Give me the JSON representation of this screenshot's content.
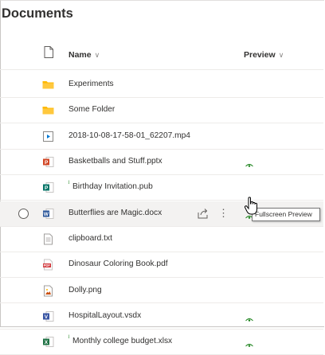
{
  "title": "Documents",
  "header": {
    "name_label": "Name",
    "preview_label": "Preview",
    "chevron": "∨"
  },
  "files": [
    {
      "name": "Experiments",
      "icon": "folder-icon",
      "type": "folder",
      "new": false,
      "preview": false
    },
    {
      "name": "Some Folder",
      "icon": "folder-icon",
      "type": "folder",
      "new": false,
      "preview": false
    },
    {
      "name": "2018-10-08-17-58-01_62207.mp4",
      "icon": "video-file-icon",
      "type": "video",
      "new": false,
      "preview": false
    },
    {
      "name": "Basketballs and Stuff.pptx",
      "icon": "powerpoint-file-icon",
      "type": "pptx",
      "new": false,
      "preview": true
    },
    {
      "name": "Birthday Invitation.pub",
      "icon": "publisher-file-icon",
      "type": "pub",
      "new": true,
      "preview": false
    },
    {
      "name": "Butterflies are Magic.docx",
      "icon": "word-file-icon",
      "type": "docx",
      "new": false,
      "preview": true,
      "selected_hover": true
    },
    {
      "name": "clipboard.txt",
      "icon": "text-file-icon",
      "type": "txt",
      "new": false,
      "preview": false
    },
    {
      "name": "Dinosaur Coloring Book.pdf",
      "icon": "pdf-file-icon",
      "type": "pdf",
      "new": false,
      "preview": false
    },
    {
      "name": "Dolly.png",
      "icon": "image-file-icon",
      "type": "png",
      "new": false,
      "preview": false
    },
    {
      "name": "HospitalLayout.vsdx",
      "icon": "visio-file-icon",
      "type": "vsdx",
      "new": false,
      "preview": true
    },
    {
      "name": "Monthly college budget.xlsx",
      "icon": "excel-file-icon",
      "type": "xlsx",
      "new": true,
      "preview": true
    }
  ],
  "new_marker": "ʲ",
  "more_glyph": "⋮",
  "tooltip": "Fullscreen Preview",
  "colors": {
    "folder": "#ffb900",
    "word": "#2b579a",
    "powerpoint": "#d24726",
    "excel": "#217346",
    "publisher": "#077568",
    "visio": "#3955a3",
    "pdf": "#d13438",
    "preview_eye": "#107c10",
    "row_hover": "#f3f2f1"
  }
}
